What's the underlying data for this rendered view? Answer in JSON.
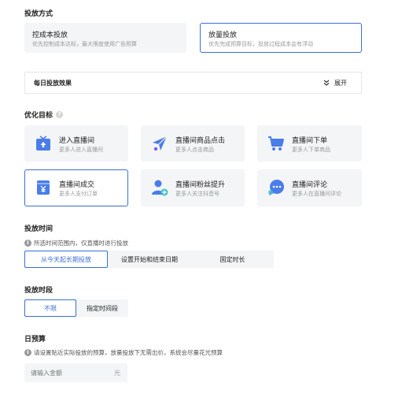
{
  "bid_mode": {
    "title": "投放方式",
    "options": [
      {
        "title": "控成本投放",
        "desc": "优先控制成本达标，最大限度使用广告预算",
        "selected": false
      },
      {
        "title": "放量投放",
        "desc": "优先完成预算目标，投放过程成本会有浮动",
        "selected": true
      }
    ]
  },
  "daily_effect": {
    "title": "每日投放效果",
    "expand_label": "展开"
  },
  "optimize": {
    "title": "优化目标",
    "help_icon": "question-icon",
    "goals": [
      {
        "title": "进入直播间",
        "desc": "更多人进入直播间",
        "icon": "tv-enter-icon",
        "color": "#4a7de8",
        "selected": false
      },
      {
        "title": "直播间商品点击",
        "desc": "更多人点击商品",
        "icon": "paper-plane-icon",
        "color": "#4a7de8",
        "selected": false
      },
      {
        "title": "直播间下单",
        "desc": "更多人下单商品",
        "icon": "cart-icon",
        "color": "#4a7de8",
        "selected": false
      },
      {
        "title": "直播间成交",
        "desc": "更多人支付订单",
        "icon": "yen-wallet-icon",
        "color": "#4a7de8",
        "selected": true
      },
      {
        "title": "直播间粉丝提升",
        "desc": "更多人关注抖音号",
        "icon": "user-add-icon",
        "color": "#4a7de8",
        "selected": false
      },
      {
        "title": "直播间评论",
        "desc": "更多人在直播间评论",
        "icon": "chat-bubble-icon",
        "color": "#4a7de8",
        "selected": false
      }
    ]
  },
  "schedule": {
    "title": "投放时间",
    "hint": "所选时间范围内，仅直播时进行投放",
    "options": [
      "从今天起长期投放",
      "设置开始和结束日期",
      "固定时长"
    ],
    "selected_index": 0
  },
  "period": {
    "title": "投放时段",
    "options": [
      "不限",
      "指定时间段"
    ],
    "selected_index": 0
  },
  "budget": {
    "title": "日预算",
    "hint": "请设置贴近实际投放的预算，放量投放下无需出价，系统会尽量花光预算",
    "placeholder": "请输入金额",
    "unit": "元"
  },
  "colors": {
    "accent": "#3b6fd6",
    "card_bg": "#f4f5f7"
  }
}
